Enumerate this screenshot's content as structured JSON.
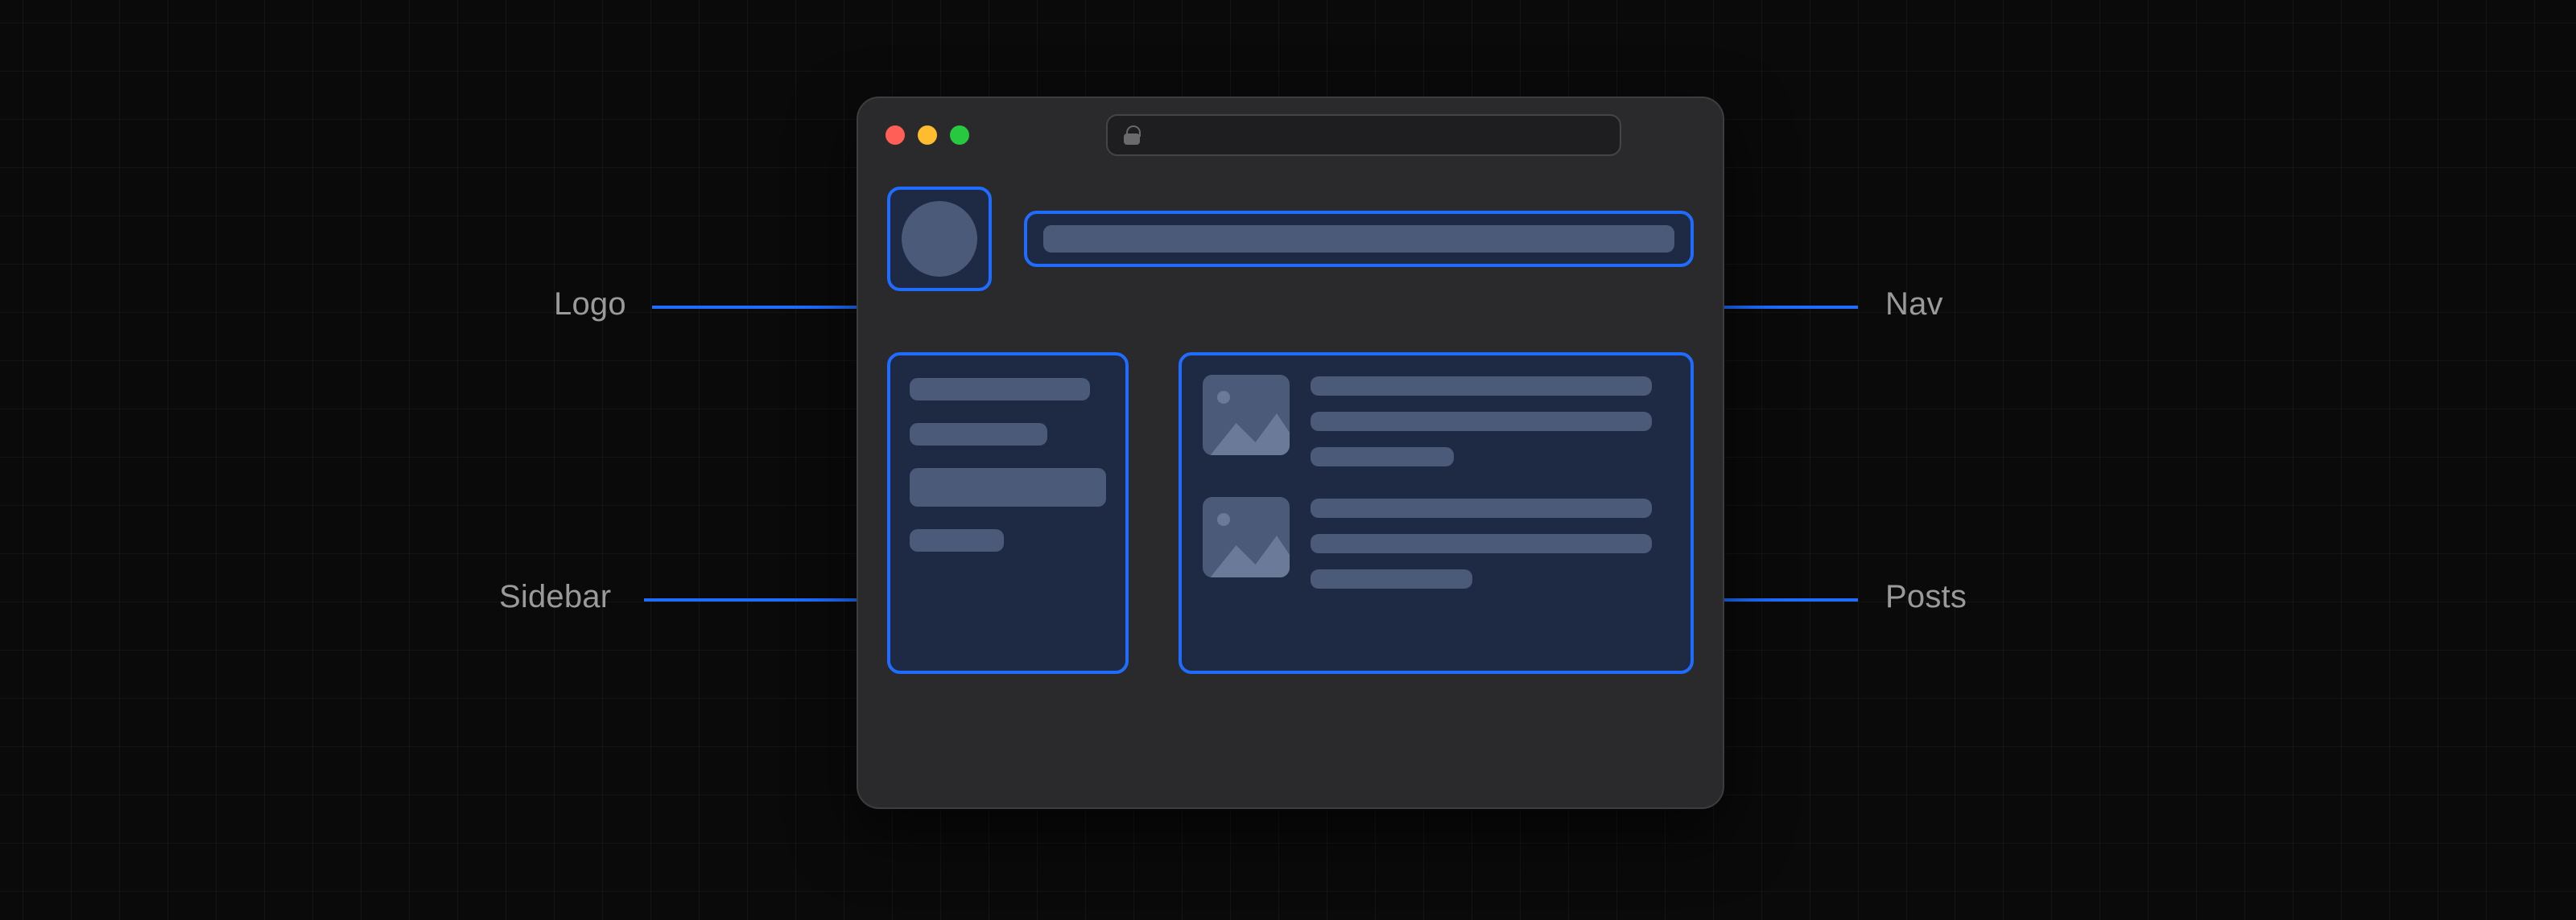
{
  "annotations": {
    "logo": "Logo",
    "nav": "Nav",
    "sidebar": "Sidebar",
    "posts": "Posts"
  },
  "colors": {
    "accent_blue": "#1f6cff",
    "region_fill": "#1e2a44",
    "placeholder": "#4a5a78",
    "window_bg": "#2a2a2c",
    "page_bg": "#0a0a0a",
    "label_text": "#9a9a9c"
  },
  "traffic_lights": [
    "close",
    "minimize",
    "zoom"
  ]
}
